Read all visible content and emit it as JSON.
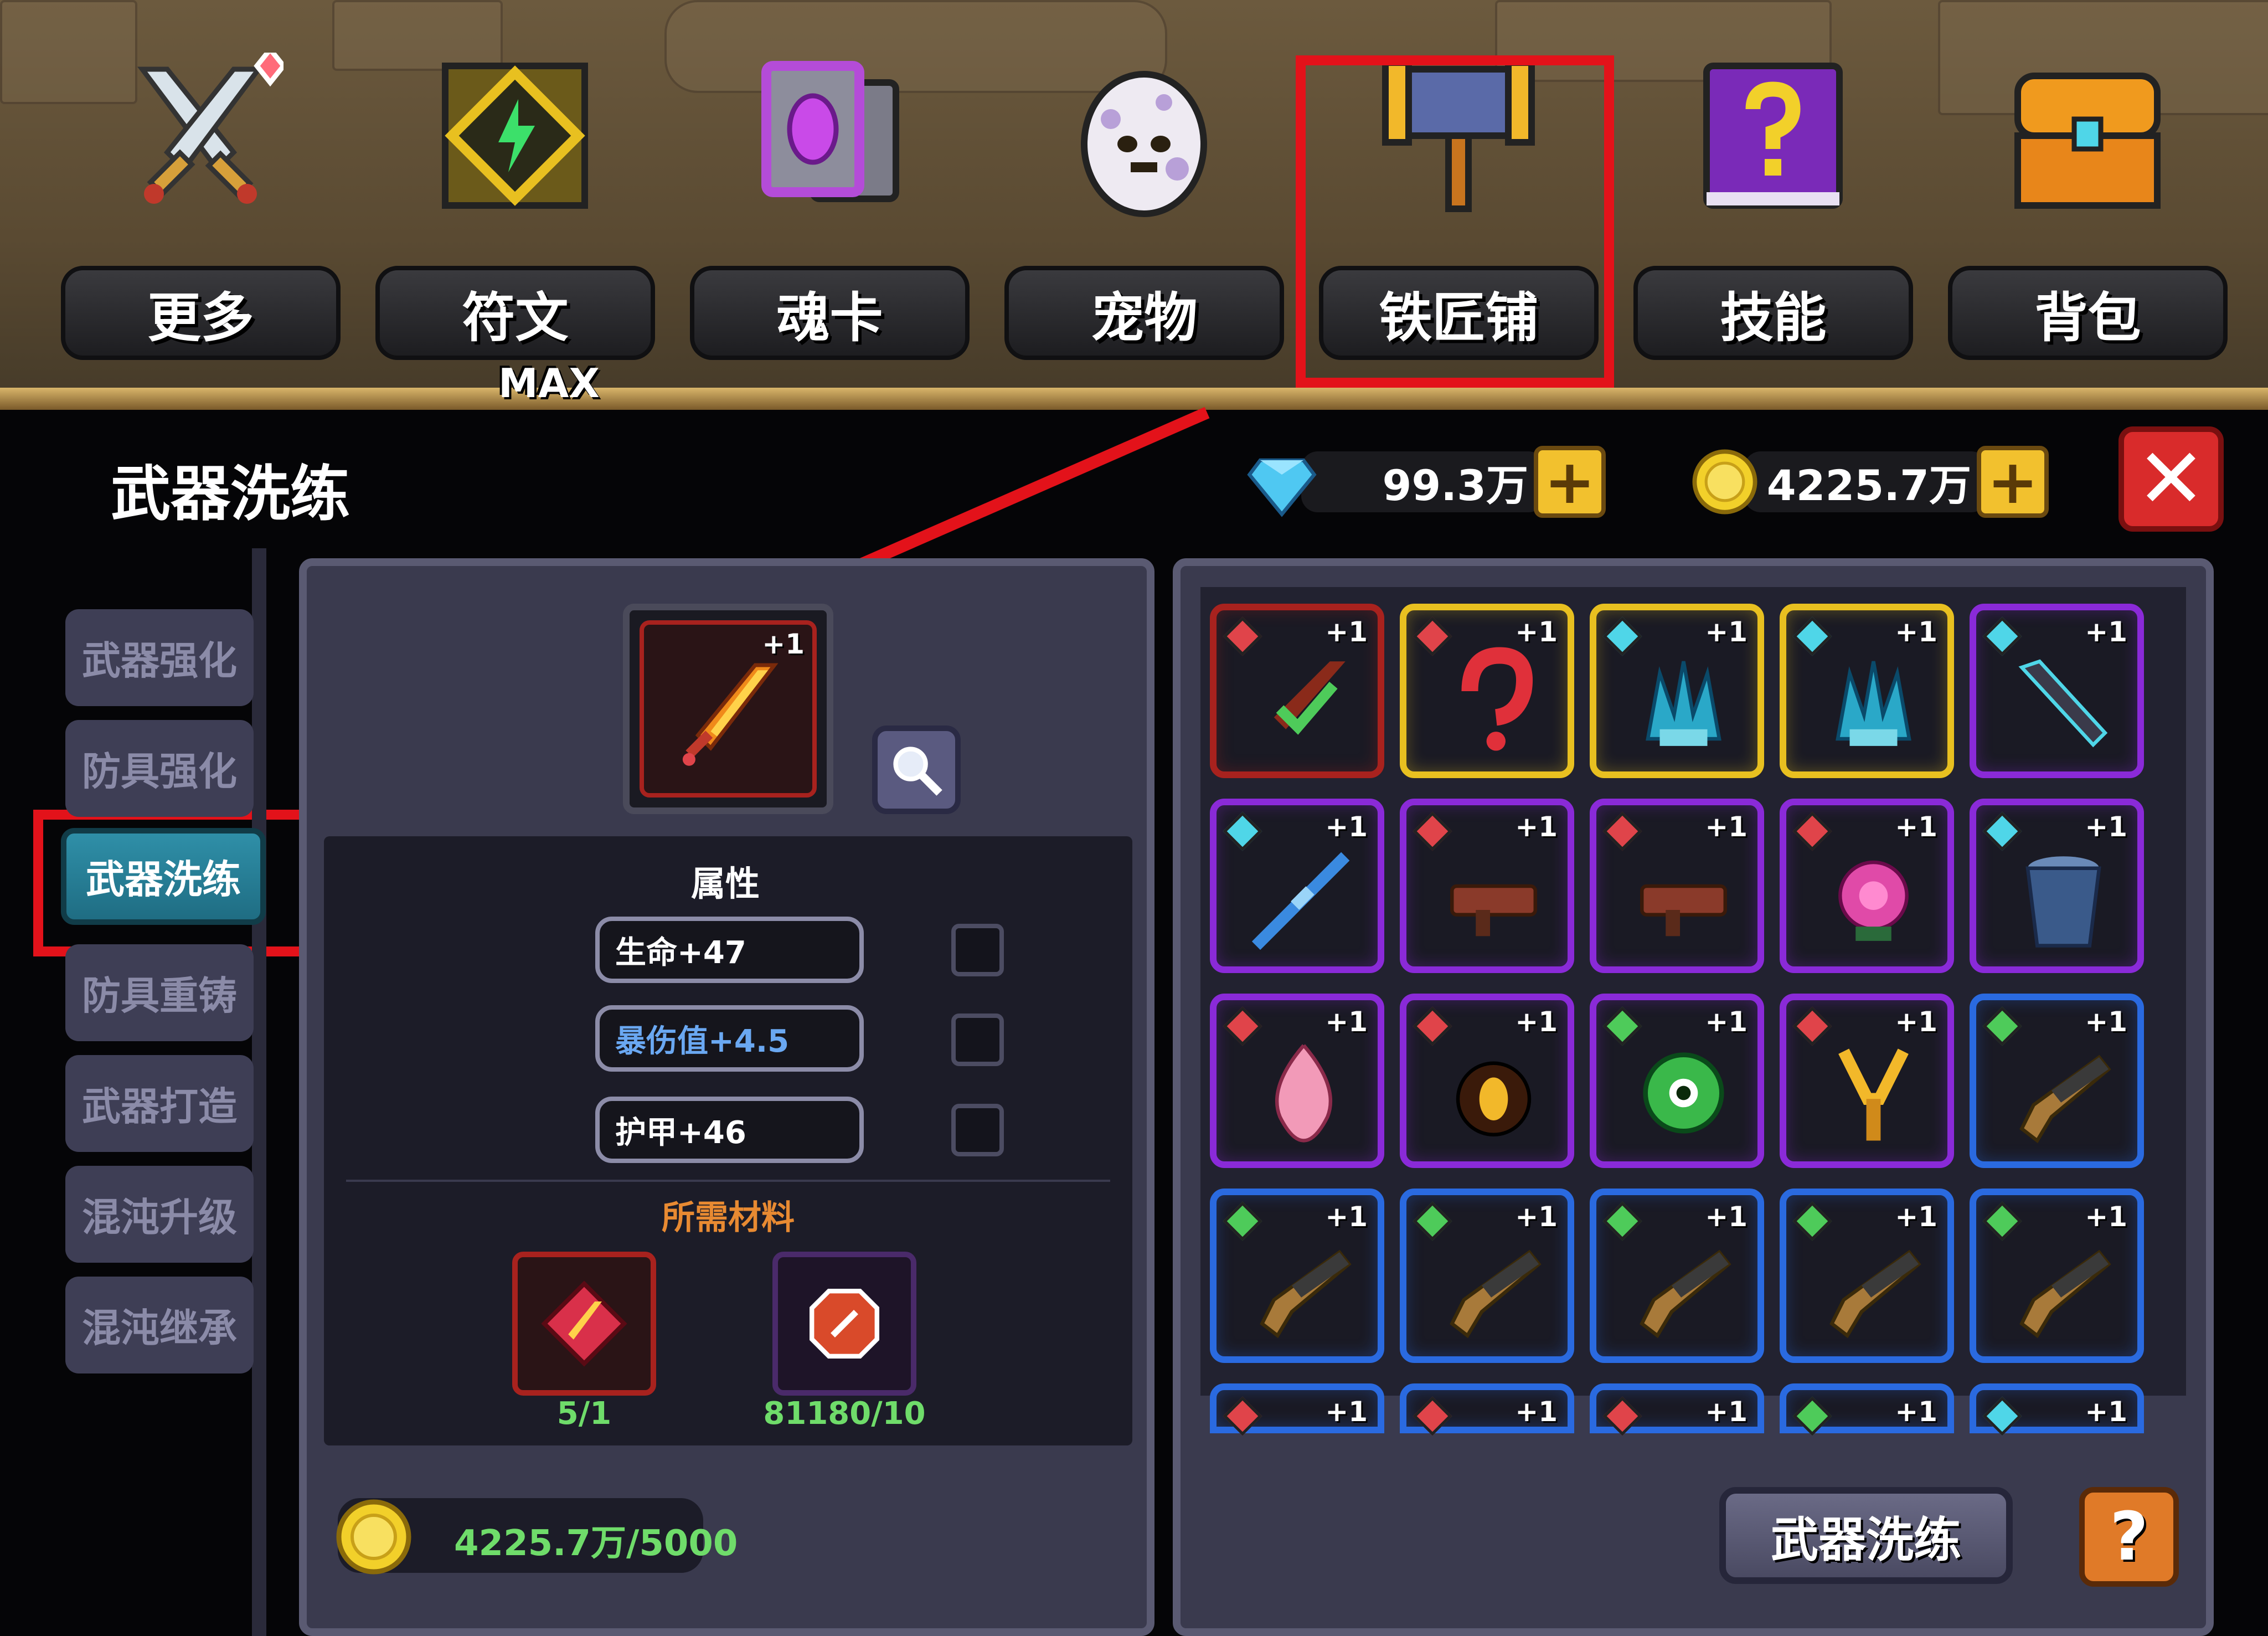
{
  "top_nav": {
    "items": [
      {
        "label": "更多",
        "icon": "crossed-swords-icon"
      },
      {
        "label": "符文",
        "icon": "rune-icon",
        "badge": "MAX"
      },
      {
        "label": "魂卡",
        "icon": "soul-card-icon"
      },
      {
        "label": "宠物",
        "icon": "pet-egg-icon"
      },
      {
        "label": "铁匠铺",
        "icon": "hammer-icon"
      },
      {
        "label": "技能",
        "icon": "skill-book-icon"
      },
      {
        "label": "背包",
        "icon": "treasure-chest-icon"
      }
    ]
  },
  "panel": {
    "title": "武器洗练",
    "diamonds": "99.3万",
    "gold": "4225.7万",
    "close_label": "✕"
  },
  "sidebar": {
    "tabs": [
      {
        "label": "武器强化",
        "active": false
      },
      {
        "label": "防具强化",
        "active": false
      },
      {
        "label": "武器洗练",
        "active": true
      },
      {
        "label": "防具重铸",
        "active": false
      },
      {
        "label": "武器打造",
        "active": false
      },
      {
        "label": "混沌升级",
        "active": false
      },
      {
        "label": "混沌继承",
        "active": false
      }
    ]
  },
  "selected_weapon": {
    "level": "+1",
    "icon": "flaming-sword-icon"
  },
  "attributes": {
    "heading": "属性",
    "stats": [
      {
        "label": "生命+47"
      },
      {
        "label": "暴伤值+4.5"
      },
      {
        "label": "护甲+46"
      }
    ]
  },
  "materials": {
    "heading": "所需材料",
    "items": [
      {
        "icon": "red-sword-material-icon",
        "count": "5/1"
      },
      {
        "icon": "red-stone-material-icon",
        "count": "81180/10"
      }
    ]
  },
  "cost": {
    "text": "4225.7万/5000"
  },
  "inventory": {
    "level_label": "+1",
    "rows": [
      [
        {
          "name": "green-sword",
          "rarity": "red",
          "gem": "red"
        },
        {
          "name": "red-hook",
          "rarity": "gold",
          "gem": "red"
        },
        {
          "name": "ice-crystal",
          "rarity": "gold",
          "gem": "cyan"
        },
        {
          "name": "ice-crystal",
          "rarity": "gold",
          "gem": "cyan"
        },
        {
          "name": "dark-blade",
          "rarity": "purple",
          "gem": "cyan"
        }
      ],
      [
        {
          "name": "blue-rifle",
          "rarity": "purple",
          "gem": "cyan"
        },
        {
          "name": "brown-launcher",
          "rarity": "purple",
          "gem": "red"
        },
        {
          "name": "brown-launcher",
          "rarity": "purple",
          "gem": "red"
        },
        {
          "name": "pink-flower",
          "rarity": "purple",
          "gem": "red"
        },
        {
          "name": "blue-bucket",
          "rarity": "purple",
          "gem": "cyan"
        }
      ],
      [
        {
          "name": "pink-flame",
          "rarity": "purple",
          "gem": "red"
        },
        {
          "name": "fire-orb",
          "rarity": "purple",
          "gem": "red"
        },
        {
          "name": "green-eye",
          "rarity": "purple",
          "gem": "green"
        },
        {
          "name": "gold-slingshot",
          "rarity": "purple",
          "gem": "red"
        },
        {
          "name": "wooden-gun",
          "rarity": "blue",
          "gem": "green"
        }
      ],
      [
        {
          "name": "wooden-gun",
          "rarity": "blue",
          "gem": "green"
        },
        {
          "name": "wooden-gun",
          "rarity": "blue",
          "gem": "green"
        },
        {
          "name": "wooden-gun",
          "rarity": "blue",
          "gem": "green"
        },
        {
          "name": "wooden-gun",
          "rarity": "blue",
          "gem": "green"
        },
        {
          "name": "wooden-gun",
          "rarity": "blue",
          "gem": "green"
        }
      ],
      [
        {
          "name": "partial",
          "rarity": "blue",
          "gem": "red"
        },
        {
          "name": "partial",
          "rarity": "blue",
          "gem": "red"
        },
        {
          "name": "partial",
          "rarity": "blue",
          "gem": "red"
        },
        {
          "name": "partial",
          "rarity": "blue",
          "gem": "green"
        },
        {
          "name": "partial",
          "rarity": "blue",
          "gem": "cyan"
        }
      ]
    ]
  },
  "actions": {
    "wash_label": "武器洗练",
    "help_label": "?"
  },
  "colors": {
    "highlight": "#e3121a",
    "rarity_red": "#a8221e",
    "rarity_gold": "#e8c020",
    "rarity_purple": "#8a2ad8",
    "rarity_blue": "#2a6ae0",
    "gem_red": "#e0444a",
    "gem_cyan": "#4fd6e8",
    "gem_green": "#4ecb5a",
    "count_green": "#6fdc6a",
    "material_orange": "#e88a32"
  }
}
